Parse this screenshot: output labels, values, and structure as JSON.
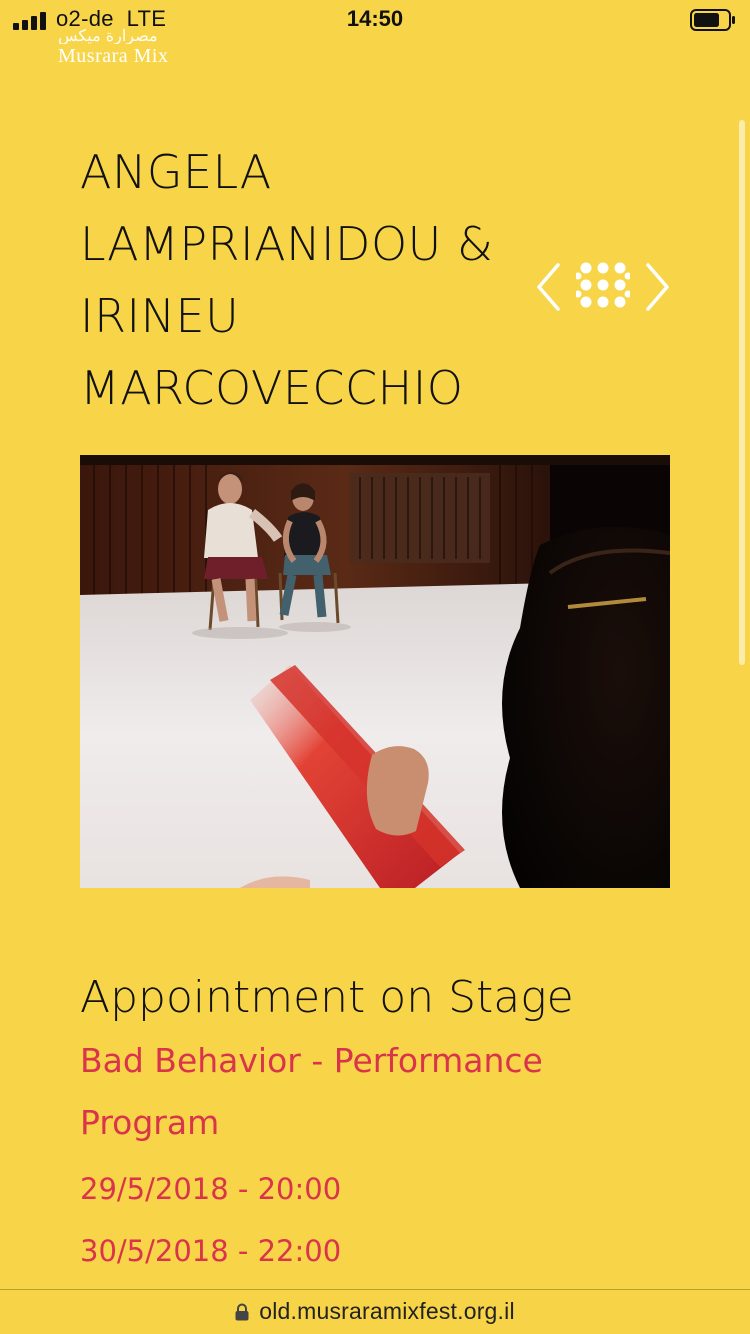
{
  "status_bar": {
    "carrier": "o2-de",
    "network": "LTE",
    "time": "14:50",
    "icons": [
      "signal-icon",
      "battery-icon"
    ]
  },
  "logo": {
    "arabic": "مصرارة ميكس",
    "latin": "Musrara Mix"
  },
  "artist": {
    "lines": [
      "ANGELA",
      "LAMPRIANIDOU &",
      "IRINEU",
      "MARCOVECCHIO"
    ]
  },
  "navigation": {
    "icons": [
      "chevron-left-icon",
      "grid-icon",
      "chevron-right-icon"
    ]
  },
  "event": {
    "title": "Appointment on Stage",
    "program": "Bad Behavior - Performance Program",
    "dates": [
      "29/5/2018 - 20:00",
      "30/5/2018 - 22:00"
    ]
  },
  "browser": {
    "url": "old.musraramixfest.org.il"
  },
  "colors": {
    "background": "#f8d548",
    "accent": "#d9344b",
    "text": "#111111",
    "logo": "#ffffff"
  }
}
